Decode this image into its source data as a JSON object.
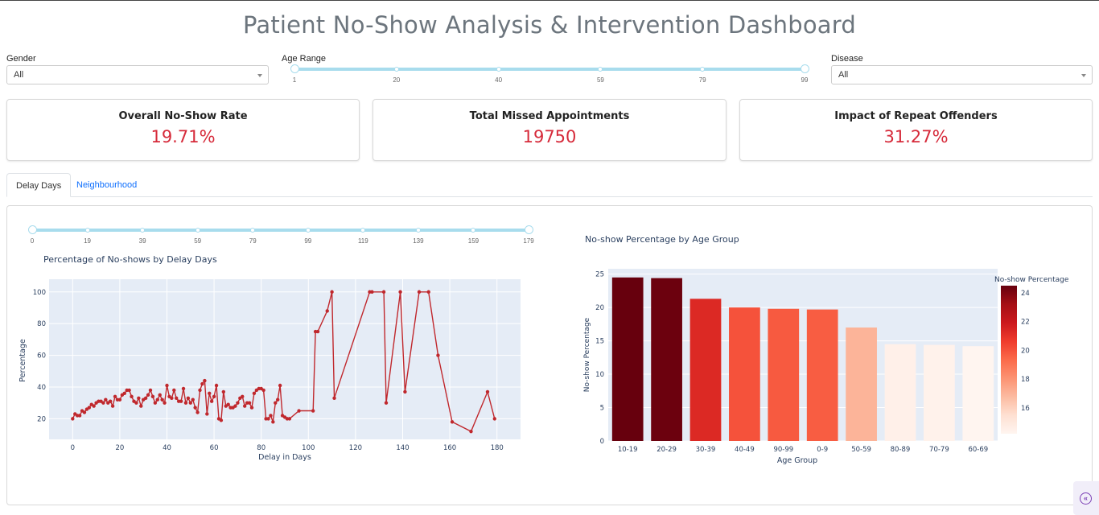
{
  "header": {
    "title": "Patient No-Show Analysis & Intervention Dashboard"
  },
  "filters": {
    "gender": {
      "label": "Gender",
      "value": "All"
    },
    "age_range": {
      "label": "Age Range",
      "ticks": [
        "1",
        "20",
        "40",
        "59",
        "79",
        "99"
      ],
      "min": 1,
      "max": 99,
      "selected": [
        1,
        99
      ]
    },
    "disease": {
      "label": "Disease",
      "value": "All"
    }
  },
  "kpis": [
    {
      "title": "Overall No-Show Rate",
      "value": "19.71%"
    },
    {
      "title": "Total Missed Appointments",
      "value": "19750"
    },
    {
      "title": "Impact of Repeat Offenders",
      "value": "31.27%"
    }
  ],
  "tabs": [
    {
      "label": "Delay Days",
      "active": true
    },
    {
      "label": "Neighbourhood",
      "active": false
    }
  ],
  "delay_slider": {
    "ticks": [
      "0",
      "19",
      "39",
      "59",
      "79",
      "99",
      "119",
      "139",
      "159",
      "179"
    ],
    "min": 0,
    "max": 179,
    "selected": [
      0,
      179
    ]
  },
  "colors": {
    "accent_red": "#d62a3a",
    "line_red": "#c0282d",
    "plot_bg": "#e5ecf6",
    "slider": "#a8dced"
  },
  "icons": {
    "collapse": "chevron-double-left-icon"
  },
  "chart_data": [
    {
      "type": "line",
      "title": "Percentage of No-shows by Delay Days",
      "xlabel": "Delay in Days",
      "ylabel": "Percentage",
      "xlim": [
        -10,
        190
      ],
      "ylim": [
        7,
        108
      ],
      "xticks": [
        0,
        20,
        40,
        60,
        80,
        100,
        120,
        140,
        160,
        180
      ],
      "yticks": [
        20,
        40,
        60,
        80,
        100
      ],
      "grid": true,
      "series": [
        {
          "x": [
            0,
            1,
            2,
            3,
            4,
            5,
            6,
            7,
            8,
            9,
            10,
            11,
            12,
            13,
            14,
            15,
            16,
            17,
            18,
            19,
            20,
            21,
            22,
            23,
            24,
            25,
            26,
            27,
            28,
            29,
            30,
            31,
            32,
            33,
            34,
            35,
            36,
            37,
            38,
            39,
            40,
            41,
            42,
            43,
            44,
            45,
            46,
            47,
            48,
            49,
            50,
            51,
            52,
            53,
            54,
            55,
            56,
            57,
            58,
            59,
            60,
            61,
            62,
            63,
            64,
            65,
            66,
            67,
            68,
            69,
            70,
            71,
            72,
            73,
            74,
            75,
            76,
            77,
            78,
            79,
            80,
            81,
            82,
            83,
            84,
            85,
            86,
            87,
            88,
            89,
            90,
            91,
            92,
            96,
            102,
            103,
            104,
            108,
            110,
            111,
            126,
            127,
            132,
            133,
            139,
            141,
            147,
            151,
            155,
            161,
            169,
            176,
            179
          ],
          "y": [
            20,
            23,
            22,
            22,
            25,
            24,
            26,
            27,
            29,
            28,
            30,
            31,
            31,
            30,
            32,
            30,
            31,
            28,
            34,
            32,
            32,
            35,
            36,
            38,
            38,
            34,
            31,
            30,
            33,
            28,
            32,
            33,
            35,
            38,
            34,
            30,
            32,
            35,
            32,
            30,
            41,
            34,
            33,
            38,
            33,
            31,
            31,
            39,
            30,
            33,
            30,
            32,
            27,
            24,
            38,
            42,
            44,
            23,
            36,
            31,
            34,
            41,
            20,
            19,
            37,
            28,
            29,
            27,
            27,
            28,
            30,
            33,
            34,
            28,
            30,
            30,
            27,
            36,
            38,
            39,
            39,
            38,
            20,
            20,
            22,
            18,
            30,
            32,
            41,
            22,
            21,
            20,
            20,
            25,
            25,
            75,
            75,
            88,
            100,
            33,
            100,
            100,
            100,
            30,
            100,
            37,
            100,
            100,
            60,
            18,
            12,
            37,
            20
          ]
        }
      ]
    },
    {
      "type": "bar",
      "title": "No-show Percentage by Age Group",
      "xlabel": "Age Group",
      "ylabel": "No-show Percentage",
      "categories": [
        "10-19",
        "20-29",
        "30-39",
        "40-49",
        "90-99",
        "0-9",
        "50-59",
        "80-89",
        "70-79",
        "60-69"
      ],
      "values": [
        24.5,
        24.4,
        21.3,
        20.0,
        19.8,
        19.7,
        17.0,
        14.5,
        14.4,
        14.2
      ],
      "ylim": [
        0,
        25.8
      ],
      "yticks": [
        0,
        5,
        10,
        15,
        20,
        25
      ],
      "grid": true,
      "colorbar": {
        "title": "No-show Percentage",
        "ticks": [
          16,
          18,
          20,
          22,
          24
        ],
        "range": [
          14.2,
          24.5
        ]
      }
    }
  ]
}
